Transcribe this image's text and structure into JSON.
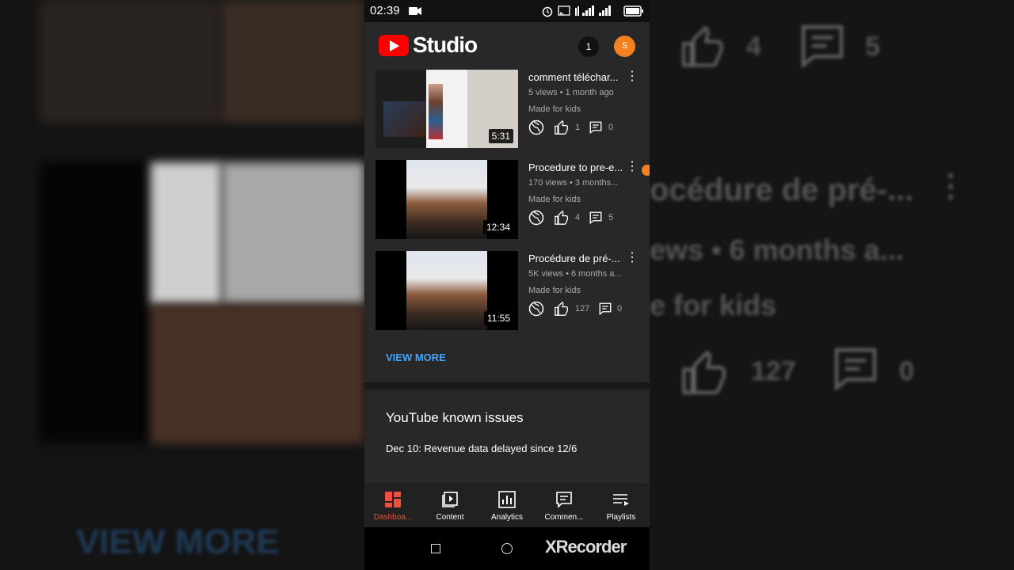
{
  "status_bar": {
    "time": "02:39"
  },
  "app": {
    "brand": "Studio",
    "notifications_count": "1",
    "avatar_initial": "S"
  },
  "videos": [
    {
      "title": "comment téléchar...",
      "meta": "5 views • 1 month ago",
      "kids_label": "Made for kids",
      "duration": "5:31",
      "likes": "1",
      "comments": "0"
    },
    {
      "title": "Procedure to pre-e...",
      "meta": "170 views • 3 months...",
      "kids_label": "Made for kids",
      "duration": "12:34",
      "likes": "4",
      "comments": "5"
    },
    {
      "title": "Procédure de pré-...",
      "meta": "5K views • 6 months a...",
      "kids_label": "Made for kids",
      "duration": "11:55",
      "likes": "127",
      "comments": "0"
    }
  ],
  "view_more": "VIEW MORE",
  "known_issues": {
    "title": "YouTube known issues",
    "item": "Dec 10: Revenue data delayed since 12/6"
  },
  "bottom_nav": [
    {
      "label": "Dashboa...",
      "active": true
    },
    {
      "label": "Content",
      "active": false
    },
    {
      "label": "Analytics",
      "active": false
    },
    {
      "label": "Commen...",
      "active": false
    },
    {
      "label": "Playlists",
      "active": false
    }
  ],
  "watermark": "XRecorder",
  "background_right": {
    "likes_top": "4",
    "comments_top": "5",
    "title": "océdure de pré-...",
    "meta": "ews • 6 months a...",
    "kids": "e for kids",
    "likes_bottom": "127",
    "comments_bottom": "0"
  },
  "background_left": {
    "view_more": "VIEW MORE"
  },
  "colors": {
    "accent_red": "#ff0000",
    "active_nav": "#f24e3d",
    "link_blue": "#3ea6ff",
    "avatar_orange": "#f4801f"
  }
}
